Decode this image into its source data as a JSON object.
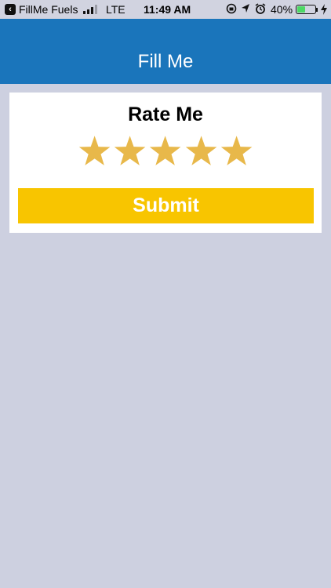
{
  "status_bar": {
    "back_app": "FillMe Fuels",
    "network": "LTE",
    "time": "11:49 AM",
    "battery_percent": "40%",
    "battery_level": 0.4,
    "icons": [
      "back-arrow-icon",
      "signal-icon",
      "orientation-lock-icon",
      "location-icon",
      "alarm-icon",
      "battery-icon",
      "charging-bolt-icon"
    ]
  },
  "nav": {
    "title": "Fill Me"
  },
  "rating": {
    "title": "Rate Me",
    "stars_total": 5,
    "stars_filled": 5,
    "star_color": "#e8b84a",
    "submit_label": "Submit",
    "submit_color": "#f8c500"
  },
  "colors": {
    "nav_background": "#1a75bb",
    "page_background": "#cdd0e0",
    "card_background": "#ffffff"
  }
}
